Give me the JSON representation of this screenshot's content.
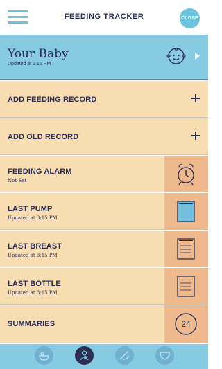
{
  "header": {
    "title": "FEEDING TRACKER",
    "close_label": "CLOSE",
    "menu_icon": "hamburger-icon"
  },
  "baby": {
    "name": "Your Baby",
    "updated": "Updated at 3:15 PM",
    "icon": "baby-face-icon",
    "arrow_icon": "play-arrow-icon"
  },
  "rows": [
    {
      "label": "ADD FEEDING RECORD",
      "icon": "plus-icon"
    },
    {
      "label": "ADD OLD RECORD",
      "icon": "plus-icon"
    },
    {
      "label": "FEEDING ALARM",
      "sub": "Not Set",
      "icon": "alarm-clock-icon"
    },
    {
      "label": "LAST PUMP",
      "sub": "Updated at 3:15 PM",
      "icon": "document-icon"
    },
    {
      "label": "LAST BREAST",
      "sub": "Updated at 3:15 PM",
      "icon": "document-icon"
    },
    {
      "label": "LAST BOTTLE",
      "sub": "Updated at 3:15 PM",
      "icon": "document-icon"
    },
    {
      "label": "SUMMARIES",
      "badge": "24",
      "icon": "calendar-24-icon"
    }
  ],
  "bottom_nav": [
    {
      "icon": "bath-icon",
      "active": false
    },
    {
      "icon": "feeding-icon",
      "active": true
    },
    {
      "icon": "sleep-icon",
      "active": false
    },
    {
      "icon": "diaper-icon",
      "active": false
    }
  ],
  "colors": {
    "navy": "#2b2f54",
    "sky": "#87cbe3",
    "accent": "#6cc3de",
    "peach": "#f8dcb2",
    "tan": "#efb98e",
    "pump_blue": "#73c0de"
  }
}
